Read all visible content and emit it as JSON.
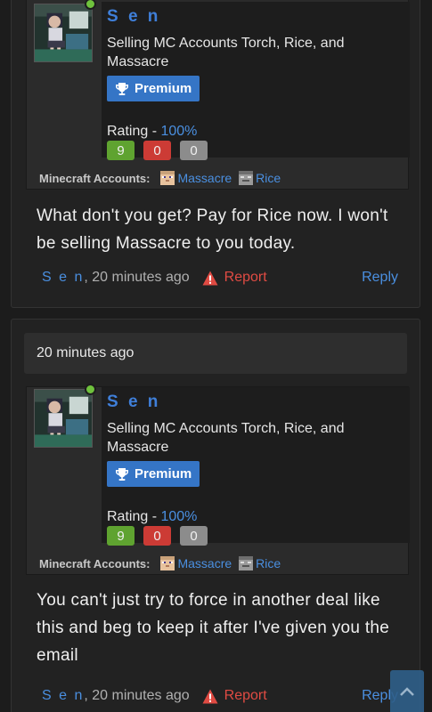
{
  "posts": [
    {
      "user": {
        "name": "Sen",
        "display_name": "S e n",
        "title": "Selling MC Accounts Torch, Rice, and Massacre",
        "badge": "Premium",
        "rating_label": "Rating - ",
        "rating_pct": "100%",
        "positive": "9",
        "negative": "0",
        "neutral": "0",
        "accounts_label": "Minecraft Accounts:",
        "accounts": [
          "Massacre",
          "Rice"
        ]
      },
      "message": "What don't you get? Pay for Rice now. I won't be selling Massacre to you today.",
      "author": "S e n",
      "time": ", 20 minutes ago",
      "report_label": "Report",
      "reply_label": "Reply"
    },
    {
      "date_bar": "20 minutes ago",
      "user": {
        "name": "Sen",
        "display_name": "S e n",
        "title": "Selling MC Accounts Torch, Rice, and Massacre",
        "badge": "Premium",
        "rating_label": "Rating - ",
        "rating_pct": "100%",
        "positive": "9",
        "negative": "0",
        "neutral": "0",
        "accounts_label": "Minecraft Accounts:",
        "accounts": [
          "Massacre",
          "Rice"
        ]
      },
      "message": "You can't just try to force in another deal like this and beg to keep it after I've given you the email",
      "author": "S e n",
      "time": ", 20 minutes ago",
      "report_label": "Report",
      "reply_label": "Reply"
    }
  ],
  "colors": {
    "link": "#4a8fe0",
    "username": "#3f7fd9",
    "premium": "#3575c6",
    "positive": "#5fa330",
    "negative": "#cc3b35",
    "neutral": "#8c8c8c",
    "report": "#e04b43",
    "online": "#6fc23d"
  },
  "icons": {
    "badge": "trophy-icon",
    "report": "warning-triangle-icon",
    "scroll": "chevron-up-icon"
  }
}
